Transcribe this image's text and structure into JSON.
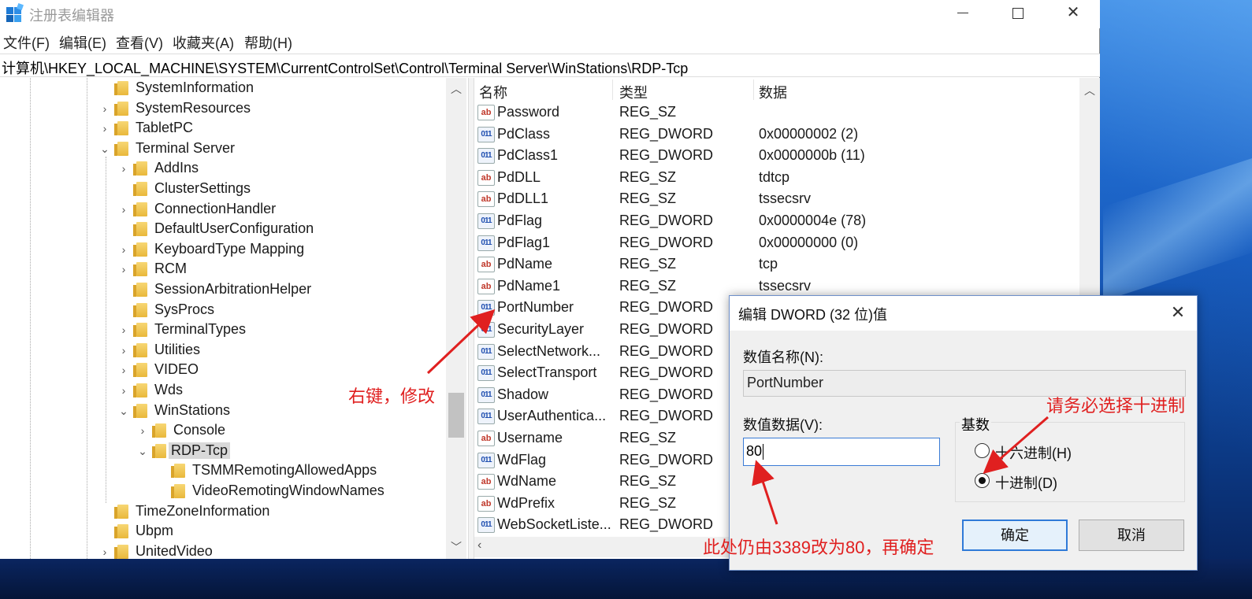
{
  "window": {
    "title": "注册表编辑器",
    "close_glyph": "✕"
  },
  "menu": {
    "items": [
      "文件(F)",
      "编辑(E)",
      "查看(V)",
      "收藏夹(A)",
      "帮助(H)"
    ]
  },
  "address": {
    "path": "计算机\\HKEY_LOCAL_MACHINE\\SYSTEM\\CurrentControlSet\\Control\\Terminal Server\\WinStations\\RDP-Tcp"
  },
  "tree": {
    "items": [
      {
        "label": "SystemInformation",
        "expander": ""
      },
      {
        "label": "SystemResources",
        "expander": "›"
      },
      {
        "label": "TabletPC",
        "expander": "›"
      },
      {
        "label": "Terminal Server",
        "expander": "⌄"
      },
      {
        "label": "AddIns",
        "expander": "›"
      },
      {
        "label": "ClusterSettings",
        "expander": ""
      },
      {
        "label": "ConnectionHandler",
        "expander": "›"
      },
      {
        "label": "DefaultUserConfiguration",
        "expander": ""
      },
      {
        "label": "KeyboardType Mapping",
        "expander": "›"
      },
      {
        "label": "RCM",
        "expander": "›"
      },
      {
        "label": "SessionArbitrationHelper",
        "expander": ""
      },
      {
        "label": "SysProcs",
        "expander": ""
      },
      {
        "label": "TerminalTypes",
        "expander": "›"
      },
      {
        "label": "Utilities",
        "expander": "›"
      },
      {
        "label": "VIDEO",
        "expander": "›"
      },
      {
        "label": "Wds",
        "expander": "›"
      },
      {
        "label": "WinStations",
        "expander": "⌄"
      },
      {
        "label": "Console",
        "expander": "›"
      },
      {
        "label": "RDP-Tcp",
        "expander": "⌄"
      },
      {
        "label": "TSMMRemotingAllowedApps",
        "expander": ""
      },
      {
        "label": "VideoRemotingWindowNames",
        "expander": ""
      },
      {
        "label": "TimeZoneInformation",
        "expander": ""
      },
      {
        "label": "Ubpm",
        "expander": ""
      },
      {
        "label": "UnitedVideo",
        "expander": "›"
      }
    ],
    "selected": "RDP-Tcp"
  },
  "list": {
    "headers": {
      "name": "名称",
      "type": "类型",
      "data": "数据"
    },
    "rows": [
      {
        "name": "Password",
        "type": "REG_SZ",
        "data": "",
        "icon": "string-value-icon"
      },
      {
        "name": "PdClass",
        "type": "REG_DWORD",
        "data": "0x00000002 (2)",
        "icon": "dword-value-icon"
      },
      {
        "name": "PdClass1",
        "type": "REG_DWORD",
        "data": "0x0000000b (11)",
        "icon": "dword-value-icon"
      },
      {
        "name": "PdDLL",
        "type": "REG_SZ",
        "data": "tdtcp",
        "icon": "string-value-icon"
      },
      {
        "name": "PdDLL1",
        "type": "REG_SZ",
        "data": "tssecsrv",
        "icon": "string-value-icon"
      },
      {
        "name": "PdFlag",
        "type": "REG_DWORD",
        "data": "0x0000004e (78)",
        "icon": "dword-value-icon"
      },
      {
        "name": "PdFlag1",
        "type": "REG_DWORD",
        "data": "0x00000000 (0)",
        "icon": "dword-value-icon"
      },
      {
        "name": "PdName",
        "type": "REG_SZ",
        "data": "tcp",
        "icon": "string-value-icon"
      },
      {
        "name": "PdName1",
        "type": "REG_SZ",
        "data": "tssecsrv",
        "icon": "string-value-icon"
      },
      {
        "name": "PortNumber",
        "type": "REG_DWORD",
        "data": "",
        "icon": "dword-value-icon"
      },
      {
        "name": "SecurityLayer",
        "type": "REG_DWORD",
        "data": "",
        "icon": "dword-value-icon"
      },
      {
        "name": "SelectNetwork...",
        "type": "REG_DWORD",
        "data": "",
        "icon": "dword-value-icon"
      },
      {
        "name": "SelectTransport",
        "type": "REG_DWORD",
        "data": "",
        "icon": "dword-value-icon"
      },
      {
        "name": "Shadow",
        "type": "REG_DWORD",
        "data": "",
        "icon": "dword-value-icon"
      },
      {
        "name": "UserAuthentica...",
        "type": "REG_DWORD",
        "data": "",
        "icon": "dword-value-icon"
      },
      {
        "name": "Username",
        "type": "REG_SZ",
        "data": "",
        "icon": "string-value-icon"
      },
      {
        "name": "WdFlag",
        "type": "REG_DWORD",
        "data": "",
        "icon": "dword-value-icon"
      },
      {
        "name": "WdName",
        "type": "REG_SZ",
        "data": "",
        "icon": "string-value-icon"
      },
      {
        "name": "WdPrefix",
        "type": "REG_SZ",
        "data": "",
        "icon": "string-value-icon"
      },
      {
        "name": "WebSocketListe...",
        "type": "REG_DWORD",
        "data": "",
        "icon": "dword-value-icon"
      }
    ],
    "icon_text": {
      "sz": "ab",
      "dword": "011"
    }
  },
  "dialog": {
    "title": "编辑 DWORD (32 位)值",
    "name_label": "数值名称(N):",
    "name_value": "PortNumber",
    "data_label": "数值数据(V):",
    "data_value": "80",
    "base_label": "基数",
    "hex_label": "十六进制(H)",
    "dec_label": "十进制(D)",
    "hex_selected": false,
    "dec_selected": true,
    "ok_label": "确定",
    "cancel_label": "取消"
  },
  "annotations": {
    "right_click": "右键，修改",
    "choose_decimal": "请务必选择十进制",
    "change_value": "此处仍由3389改为80，再确定",
    "color": "#e02020"
  }
}
